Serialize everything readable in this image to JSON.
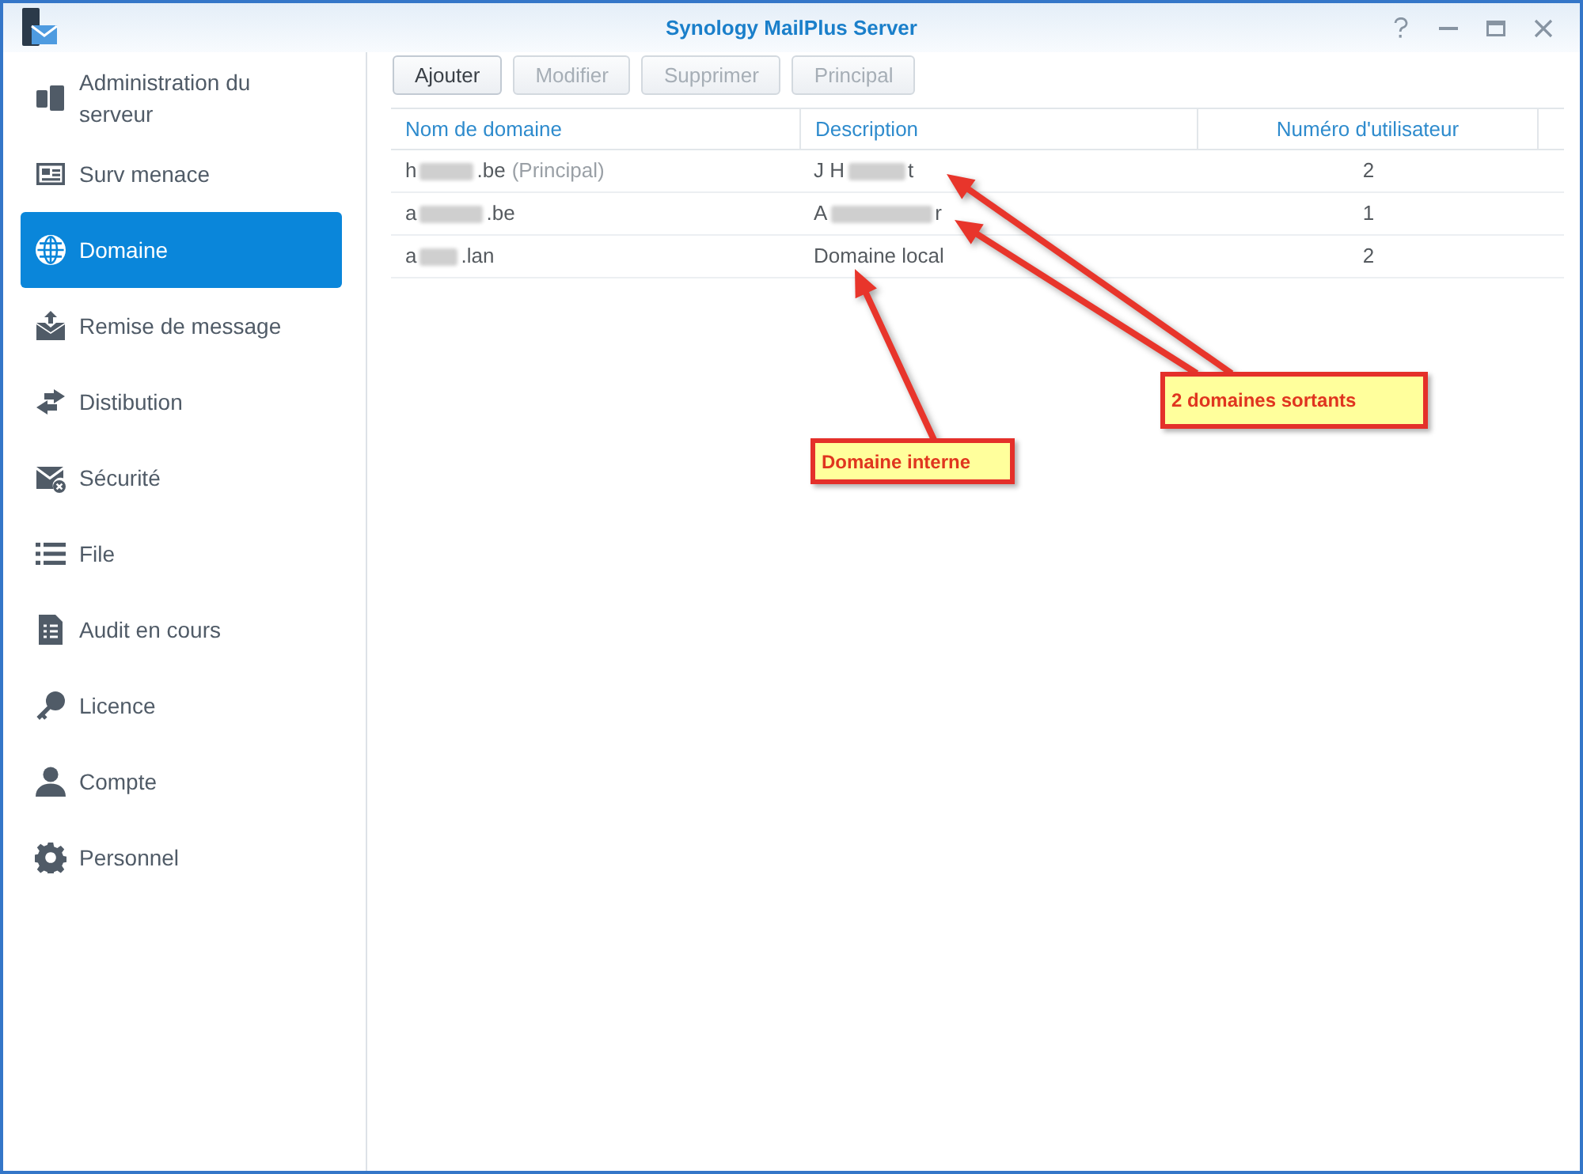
{
  "window": {
    "title": "Synology MailPlus Server"
  },
  "sidebar": {
    "items": [
      {
        "label": "Administration du serveur",
        "selected": false
      },
      {
        "label": "Surv menace",
        "selected": false
      },
      {
        "label": "Domaine",
        "selected": true
      },
      {
        "label": "Remise de message",
        "selected": false
      },
      {
        "label": "Distibution",
        "selected": false
      },
      {
        "label": "Sécurité",
        "selected": false
      },
      {
        "label": "File",
        "selected": false
      },
      {
        "label": "Audit en cours",
        "selected": false
      },
      {
        "label": "Licence",
        "selected": false
      },
      {
        "label": "Compte",
        "selected": false
      },
      {
        "label": "Personnel",
        "selected": false
      }
    ]
  },
  "toolbar": {
    "buttons": [
      {
        "label": "Ajouter",
        "disabled": false
      },
      {
        "label": "Modifier",
        "disabled": true
      },
      {
        "label": "Supprimer",
        "disabled": true
      },
      {
        "label": "Principal",
        "disabled": true
      }
    ]
  },
  "table": {
    "columns": [
      "Nom de domaine",
      "Description",
      "Numéro d'utilisateur"
    ],
    "rows": [
      {
        "domain": [
          {
            "kind": "text",
            "text": "h"
          },
          {
            "kind": "redacted"
          },
          {
            "kind": "text",
            "text": ".be"
          }
        ],
        "tag": "(Principal)",
        "description": [
          {
            "kind": "text",
            "text": "J H"
          },
          {
            "kind": "redacted"
          },
          {
            "kind": "text",
            "text": "t"
          }
        ],
        "users": "2"
      },
      {
        "domain": [
          {
            "kind": "text",
            "text": "a"
          },
          {
            "kind": "redacted"
          },
          {
            "kind": "text",
            "text": ".be"
          }
        ],
        "description": [
          {
            "kind": "text",
            "text": "A"
          },
          {
            "kind": "redacted"
          },
          {
            "kind": "text",
            "text": "r"
          }
        ],
        "users": "1"
      },
      {
        "domain": [
          {
            "kind": "text",
            "text": "a"
          },
          {
            "kind": "redacted"
          },
          {
            "kind": "text",
            "text": ".lan"
          }
        ],
        "description": [
          {
            "kind": "text",
            "text": "Domaine local"
          }
        ],
        "users": "2"
      }
    ]
  },
  "annotations": [
    {
      "text": "2 domaines sortants"
    },
    {
      "text": "Domaine interne"
    }
  ]
}
